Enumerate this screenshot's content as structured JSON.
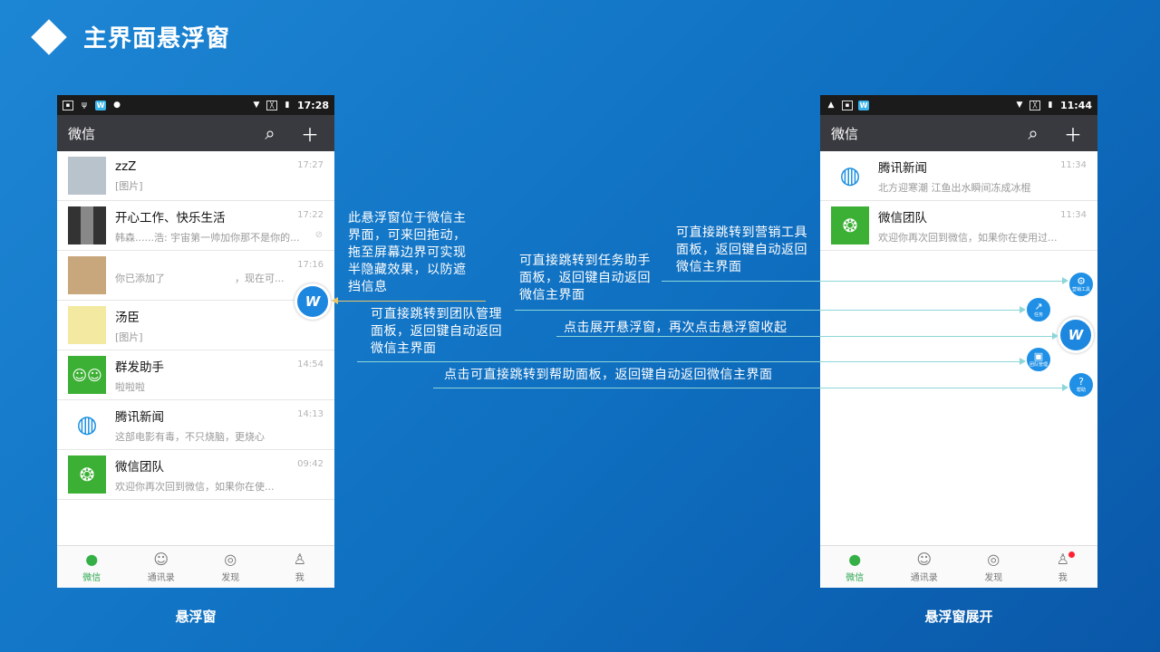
{
  "page": {
    "title": "主界面悬浮窗"
  },
  "left_phone": {
    "status_time": "17:28",
    "app_title": "微信",
    "caption": "悬浮窗",
    "chats": [
      {
        "name": "zzZ",
        "msg": "[图片]",
        "time": "17:27"
      },
      {
        "name": "开心工作、快乐生活",
        "msg": "韩森......浩: 宇宙第一帅加你那不是你的...",
        "time": "17:22"
      },
      {
        "name": "",
        "msg": "你已添加了　　　　　　　，现在可...",
        "time": "17:16"
      },
      {
        "name": "汤臣",
        "msg": "[图片]",
        "time": ""
      },
      {
        "name": "群发助手",
        "msg": "啦啦啦",
        "time": "14:54"
      },
      {
        "name": "腾讯新闻",
        "msg": "这部电影有毒，不只烧脑，更烧心",
        "time": "14:13"
      },
      {
        "name": "微信团队",
        "msg": "欢迎你再次回到微信，如果你在使...",
        "time": "09:42"
      }
    ],
    "nav": [
      "微信",
      "通讯录",
      "发现",
      "我"
    ]
  },
  "right_phone": {
    "status_time": "11:44",
    "app_title": "微信",
    "caption": "悬浮窗展开",
    "chats": [
      {
        "name": "腾讯新闻",
        "msg": "北方迎寒潮 江鱼出水瞬间冻成冰棍",
        "time": "11:34"
      },
      {
        "name": "微信团队",
        "msg": "欢迎你再次回到微信，如果你在使用过...",
        "time": "11:34"
      }
    ],
    "nav": [
      "微信",
      "通讯录",
      "发现",
      "我"
    ],
    "float_menu": [
      "营销工具",
      "任务",
      "团队管理",
      "帮助"
    ]
  },
  "annotations": {
    "a1": "此悬浮窗位于微信主界面，可来回拖动，拖至屏幕边界可实现半隐藏效果，以防遮挡信息",
    "a2": "可直接跳转到任务助手面板，返回键自动返回微信主界面",
    "a3": "可直接跳转到营销工具面板，返回键自动返回微信主界面",
    "a4": "可直接跳转到团队管理面板，返回键自动返回微信主界面",
    "a5": "点击展开悬浮窗，再次点击悬浮窗收起",
    "a6": "点击可直接跳转到帮助面板，返回键自动返回微信主界面"
  },
  "colors": {
    "accent": "#1d87e0",
    "wechat_green": "#2aa64f",
    "line": "#8cd6d8"
  }
}
